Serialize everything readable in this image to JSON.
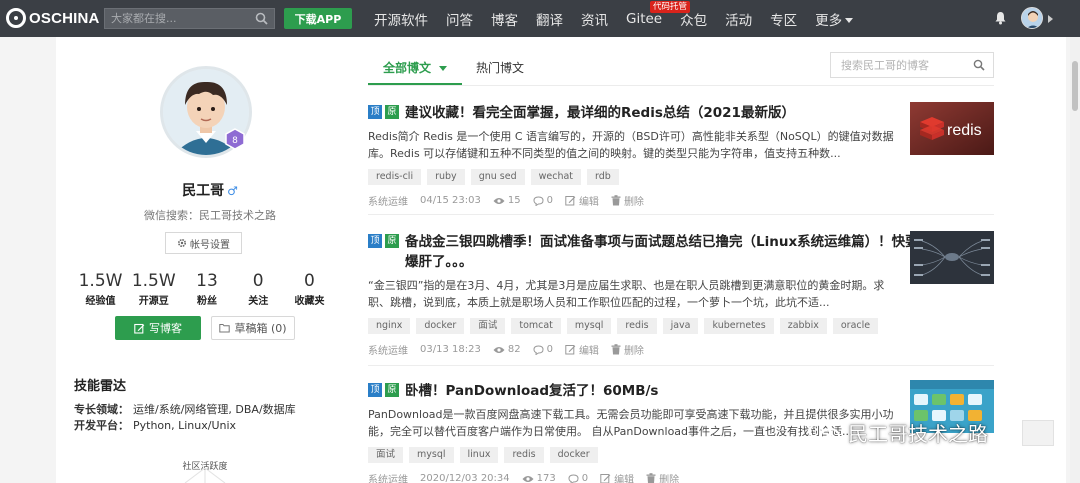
{
  "topnav": {
    "logo": "OSCHINA",
    "search_placeholder": "大家都在搜...",
    "download_app": "下载APP",
    "items": [
      "开源软件",
      "问答",
      "博客",
      "翻译",
      "资讯",
      "Gitee",
      "众包",
      "活动",
      "专区",
      "更多"
    ],
    "gitee_badge": "代码托管"
  },
  "profile": {
    "level": "8",
    "name": "民工哥",
    "gender_icon": "male-icon",
    "wechat": "微信搜索：民工哥技术之路",
    "account_settings": "帐号设置",
    "stats": [
      {
        "value": "1.5W",
        "label": "经验值"
      },
      {
        "value": "1.5W",
        "label": "开源豆"
      },
      {
        "value": "13",
        "label": "粉丝"
      },
      {
        "value": "0",
        "label": "关注"
      },
      {
        "value": "0",
        "label": "收藏夹"
      }
    ],
    "write_blog": "写博客",
    "drafts": "草稿箱 (0)",
    "skills_title": "技能雷达",
    "expertise_label": "专长领域：",
    "expertise_value": "运维/系统/网络管理, DBA/数据库",
    "platform_label": "开发平台：",
    "platform_value": "Python, Linux/Unix",
    "radar_label": "社区活跃度"
  },
  "blog": {
    "tab_all": "全部博文",
    "tab_hot": "热门博文",
    "search_placeholder": "搜索民工哥的博客",
    "badge_top": "顶",
    "badge_orig": "原",
    "edit_label": "编辑",
    "delete_label": "删除",
    "posts": [
      {
        "title": "建议收藏！看完全面掌握，最详细的Redis总结（2021最新版）",
        "desc": "Redis简介 Redis 是一个使用 C 语言编写的，开源的（BSD许可）高性能非关系型（NoSQL）的键值对数据库。Redis 可以存储键和五种不同类型的值之间的映射。键的类型只能为字符串，值支持五种数...",
        "tags": [
          "redis-cli",
          "ruby",
          "gnu sed",
          "wechat",
          "rdb"
        ],
        "category": "系统运维",
        "date": "04/15 23:03",
        "views": "15",
        "comments": "0",
        "thumb_text": "redis"
      },
      {
        "title": "备战金三银四跳槽季！面试准备事项与面试题总结已撸完（Linux系统运维篇）！快要爆肝了。。。",
        "desc": "“金三银四”指的是在3月、4月，尤其是3月是应届生求职、也是在职人员跳槽到更满意职位的黄金时期。求职、跳槽，说到底，本质上就是职场人员和工作职位匹配的过程，一个萝卜一个坑，此坑不适...",
        "tags": [
          "nginx",
          "docker",
          "面试",
          "tomcat",
          "mysql",
          "redis",
          "java",
          "kubernetes",
          "zabbix",
          "oracle"
        ],
        "category": "系统运维",
        "date": "03/13 18:23",
        "views": "82",
        "comments": "0"
      },
      {
        "title": "卧槽！PanDownload复活了！60MB/s",
        "desc": "PanDownload是一款百度网盘高速下载工具。无需会员功能即可享受高速下载功能，并且提供很多实用小功能，完全可以替代百度客户端作为日常使用。 自从PanDownload事件之后，一直也没有找到合适...",
        "tags": [
          "面试",
          "mysql",
          "linux",
          "redis",
          "docker"
        ],
        "category": "系统运维",
        "date": "2020/12/03 20:34",
        "views": "173",
        "comments": "0"
      }
    ]
  },
  "watermark": "民工哥技术之路",
  "colors": {
    "nav_bg": "#3b3f45",
    "green": "#2d9d4e",
    "badge_blue": "#2a7ec7",
    "gitee_red": "#d9231b"
  }
}
